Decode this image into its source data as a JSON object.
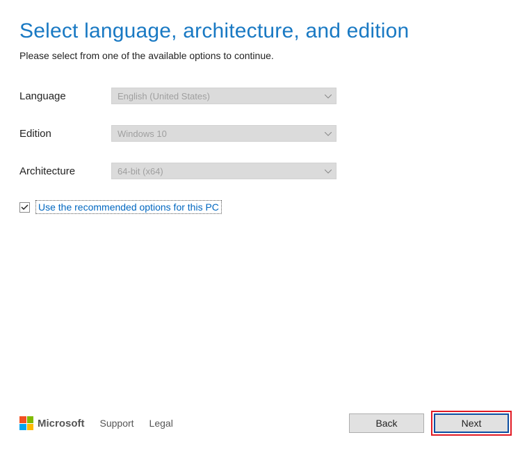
{
  "heading": "Select language, architecture, and edition",
  "subheading": "Please select from one of the available options to continue.",
  "form": {
    "language": {
      "label": "Language",
      "value": "English (United States)"
    },
    "edition": {
      "label": "Edition",
      "value": "Windows 10"
    },
    "architecture": {
      "label": "Architecture",
      "value": "64-bit (x64)"
    }
  },
  "checkbox": {
    "checked": true,
    "label": "Use the recommended options for this PC"
  },
  "footer": {
    "brand": "Microsoft",
    "support": "Support",
    "legal": "Legal",
    "back": "Back",
    "next": "Next"
  }
}
